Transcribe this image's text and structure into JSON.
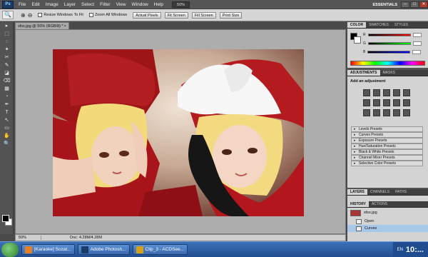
{
  "app": {
    "logo": "Ps",
    "menus": [
      "File",
      "Edit",
      "Image",
      "Layer",
      "Select",
      "Filter",
      "View",
      "Window",
      "Help"
    ],
    "zoom_menu_value": "50%",
    "workspace": "ESSENTIALS",
    "window_controls": [
      "–",
      "□",
      "✕"
    ]
  },
  "options_bar": {
    "zoom_in": "⊕",
    "zoom_out": "⊖",
    "resize_windows": "Resize Windows To Fit",
    "zoom_all": "Zoom All Windows",
    "buttons": [
      "Actual Pixels",
      "Fit Screen",
      "Fill Screen",
      "Print Size"
    ]
  },
  "document": {
    "tab_title": "sfss.jpg @ 50% (RGB/8) *",
    "tab_close": "×",
    "zoom": "50%",
    "doc_info": "Doc: 4.28M/4.28M"
  },
  "panels": {
    "color_tabs": [
      "COLOR",
      "SWATCHES",
      "STYLES"
    ],
    "color_channels": [
      "R",
      "G",
      "B"
    ],
    "adjustments_tabs": [
      "ADJUSTMENTS",
      "MASKS"
    ],
    "adjustments_title": "Add an adjustment",
    "presets": [
      "Levels Presets",
      "Curves Presets",
      "Exposure Presets",
      "Hue/Saturation Presets",
      "Black & White Presets",
      "Channel Mixer Presets",
      "Selective Color Presets"
    ],
    "layers_tabs": [
      "LAYERS",
      "CHANNELS",
      "PATHS"
    ],
    "history_tabs": [
      "HISTORY",
      "ACTIONS"
    ],
    "history": [
      {
        "label": "sfss.jpg",
        "type": "snapshot"
      },
      {
        "label": "Open",
        "type": "step"
      },
      {
        "label": "Curves",
        "type": "step"
      }
    ]
  },
  "tools": [
    "▸",
    "⬚",
    "◌",
    "✦",
    "✂",
    "✎",
    "◪",
    "⌫",
    "▦",
    "◔",
    "✒",
    "T",
    "↖",
    "▭",
    "✋",
    "🔍"
  ],
  "taskbar": {
    "tasks": [
      {
        "label": "[Karaoke] Sozat...",
        "icon_color": "#e67e22"
      },
      {
        "label": "Adobe Photosh...",
        "icon_color": "#1b3c66"
      },
      {
        "label": "Clip_3 - ACDSee...",
        "icon_color": "#d4a017"
      }
    ],
    "tray_lang": "EN",
    "clock": "10:..."
  }
}
